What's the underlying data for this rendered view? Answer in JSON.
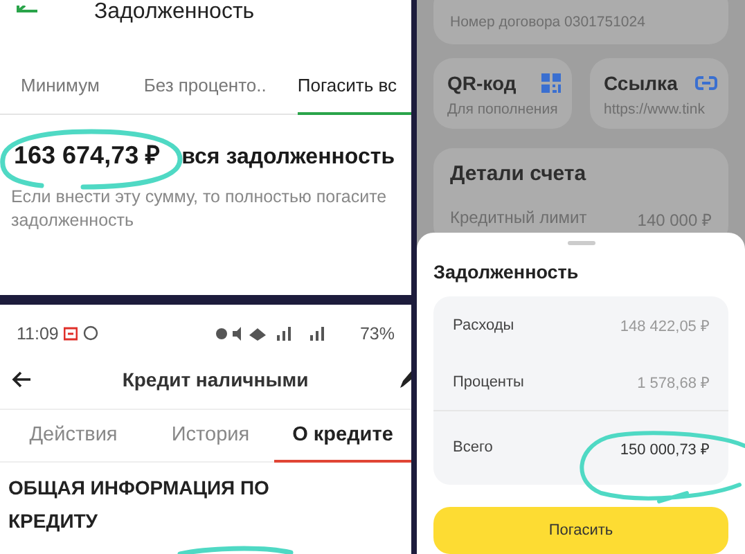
{
  "debt_screen": {
    "title": "Задолженность",
    "tabs": [
      {
        "label": "Минимум",
        "selected": false
      },
      {
        "label": "Без проценто..",
        "selected": false
      },
      {
        "label": "Погасить вс",
        "selected": true
      }
    ],
    "amount": "163 674,73 ₽",
    "amount_label": "вся задолженность",
    "hint": "Если внести эту сумму, то полностью погасите задолженность"
  },
  "loan_screen": {
    "status_bar": {
      "time": "11:09",
      "battery": "73%"
    },
    "title": "Кредит наличными",
    "tabs": [
      {
        "label": "Действия",
        "selected": false
      },
      {
        "label": "История",
        "selected": false
      },
      {
        "label": "О кредите",
        "selected": true
      }
    ],
    "section_heading": "ОБЩАЯ ИНФОРМАЦИЯ ПО КРЕДИТУ"
  },
  "account_screen": {
    "contract_number": "Номер договора 0301751024",
    "shortcuts": [
      {
        "kind": "qr",
        "title": "QR-код",
        "subtitle": "Для пополнения"
      },
      {
        "kind": "link",
        "title": "Ссылка",
        "subtitle": "https://www.tink"
      }
    ],
    "details": {
      "title": "Детали счета",
      "rows": [
        {
          "label": "Кредитный лимит",
          "value": "140 000 ₽"
        }
      ]
    },
    "sheet": {
      "title": "Задолженность",
      "rows": [
        {
          "label": "Расходы",
          "value": "148 422,05 ₽"
        },
        {
          "label": "Проценты",
          "value": "1 578,68 ₽"
        }
      ],
      "total": {
        "label": "Всего",
        "value": "150 000,73 ₽"
      },
      "button": "Погасить"
    }
  }
}
